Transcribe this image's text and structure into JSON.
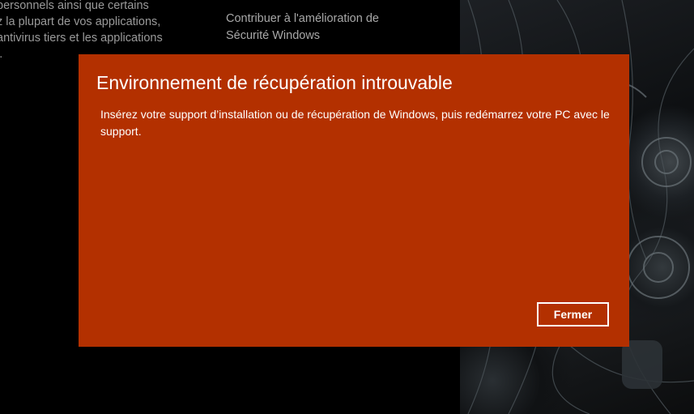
{
  "background": {
    "left_text": [
      "personnels ainsi que certains",
      "z la plupart de vos applications,",
      "antivirus tiers et les applications",
      "l."
    ],
    "right_link_lines": [
      "Contribuer à l'amélioration de",
      "Sécurité Windows"
    ]
  },
  "dialog": {
    "title": "Environnement de récupération introuvable",
    "message": "Insérez votre support d’installation ou de récupération de Windows, puis redémarrez votre PC avec le support.",
    "close_label": "Fermer",
    "accent_color": "#b33000"
  }
}
